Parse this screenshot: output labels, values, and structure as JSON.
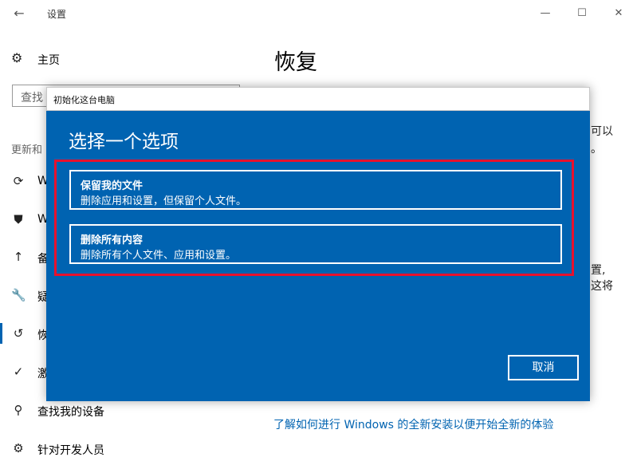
{
  "window": {
    "title": "设置",
    "back_icon": "←",
    "minimize_icon": "—",
    "maximize_icon": "☐",
    "close_icon": "✕"
  },
  "sidebar": {
    "home": {
      "icon": "⚙",
      "label": "主页"
    },
    "search_placeholder": "查找",
    "section_label": "更新和",
    "items": [
      {
        "icon": "⟳",
        "label": "W",
        "active": false
      },
      {
        "icon": "⛊",
        "label": "W",
        "active": false
      },
      {
        "icon": "↑",
        "label": "备",
        "active": false
      },
      {
        "icon": "🔧",
        "label": "疑",
        "active": false
      },
      {
        "icon": "↺",
        "label": "恢",
        "active": true
      },
      {
        "icon": "✓",
        "label": "激",
        "active": false
      },
      {
        "icon": "⚲",
        "label": "查找我的设备",
        "active": false
      },
      {
        "icon": "⚙",
        "label": "针对开发人员",
        "active": false
      }
    ]
  },
  "main": {
    "title": "恢复",
    "bg_fragments": [
      "可以",
      "。",
      "置,",
      "这将"
    ],
    "link": "了解如何进行 Windows 的全新安装以便开始全新的体验"
  },
  "dialog": {
    "title": "初始化这台电脑",
    "heading": "选择一个选项",
    "options": [
      {
        "title": "保留我的文件",
        "desc": "删除应用和设置，但保留个人文件。"
      },
      {
        "title": "删除所有内容",
        "desc": "删除所有个人文件、应用和设置。"
      }
    ],
    "cancel": "取消",
    "highlight_color": "#e8112d",
    "accent_color": "#0063b1"
  }
}
